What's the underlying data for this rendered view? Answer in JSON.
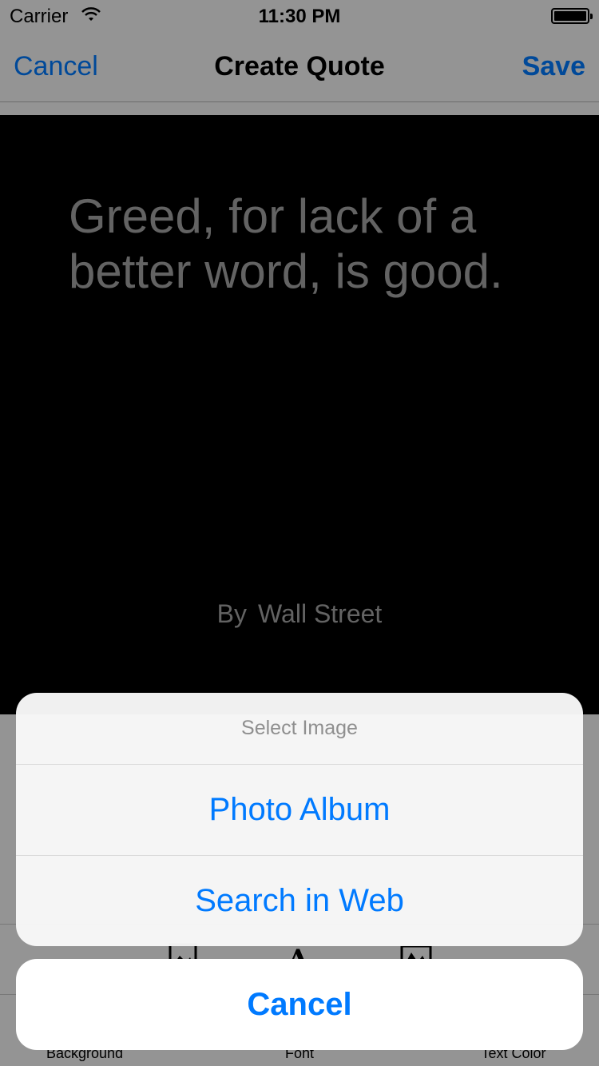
{
  "status_bar": {
    "carrier": "Carrier",
    "time": "11:30 PM"
  },
  "nav_bar": {
    "cancel_label": "Cancel",
    "title": "Create Quote",
    "save_label": "Save"
  },
  "quote": {
    "text": "Greed, for lack of a better word, is good.",
    "by_label": "By",
    "author": "Wall Street"
  },
  "toolbar": {
    "items": [
      {
        "label": "Background",
        "icon": "image-icon"
      },
      {
        "label": "Font",
        "icon": "font-icon"
      },
      {
        "label": "Text Color",
        "icon": "color-icon"
      }
    ]
  },
  "action_sheet": {
    "title": "Select Image",
    "options": [
      {
        "label": "Photo Album"
      },
      {
        "label": "Search in Web"
      }
    ],
    "cancel_label": "Cancel"
  },
  "colors": {
    "accent": "#007aff",
    "canvas": "#000000",
    "quote_text": "#a6a6a6"
  }
}
